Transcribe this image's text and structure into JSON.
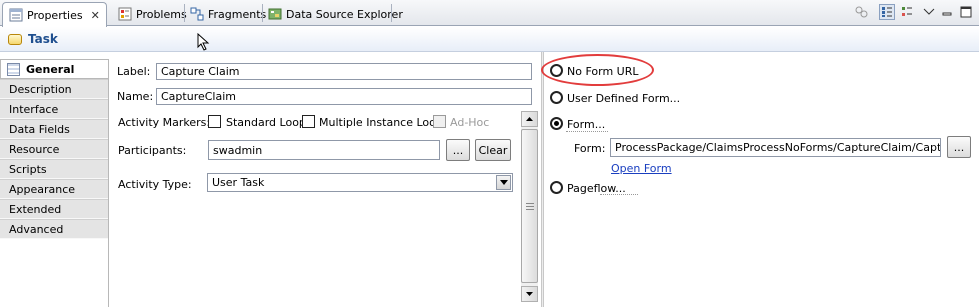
{
  "tabs": [
    {
      "label": "Properties",
      "active": true,
      "icon": "properties-icon"
    },
    {
      "label": "Problems",
      "active": false,
      "icon": "problems-icon"
    },
    {
      "label": "Fragments",
      "active": false,
      "icon": "fragments-icon"
    },
    {
      "label": "Data Source Explorer",
      "active": false,
      "icon": "data-source-icon"
    }
  ],
  "tab_close_glyph": "✕",
  "header": {
    "title": "Task",
    "icon": "task-icon"
  },
  "sidebar": {
    "items": [
      {
        "label": "General",
        "active": true
      },
      {
        "label": "Description"
      },
      {
        "label": "Interface"
      },
      {
        "label": "Data Fields"
      },
      {
        "label": "Resource"
      },
      {
        "label": "Scripts"
      },
      {
        "label": "Appearance"
      },
      {
        "label": "Extended"
      },
      {
        "label": "Advanced"
      }
    ]
  },
  "general": {
    "label_caption": "Label:",
    "label_value": "Capture Claim",
    "name_caption": "Name:",
    "name_value": "CaptureClaim",
    "markers_caption": "Activity Markers:",
    "standard_loop": "Standard Loop",
    "multiple_instance_loop": "Multiple Instance Loop",
    "ad_hoc": "Ad-Hoc",
    "participants_caption": "Participants:",
    "participants_value": "swadmin",
    "browse_label": "...",
    "clear_label": "Clear",
    "activity_type_caption": "Activity Type:",
    "activity_type_value": "User Task"
  },
  "form_panel": {
    "no_form_url": "No Form URL",
    "user_defined_form": "User Defined Form...",
    "form_option": "Form...",
    "form_caption": "Form:",
    "form_value": "ProcessPackage/ClaimsProcessNoForms/CaptureClaim/CaptureClair",
    "browse_label": "...",
    "open_form": "Open Form",
    "pageflow": "Pageflow...",
    "selected_option": "Form..."
  },
  "colors": {
    "annotation": "#e23c3c",
    "link": "#1a3fc0",
    "title": "#1f4f8f"
  }
}
